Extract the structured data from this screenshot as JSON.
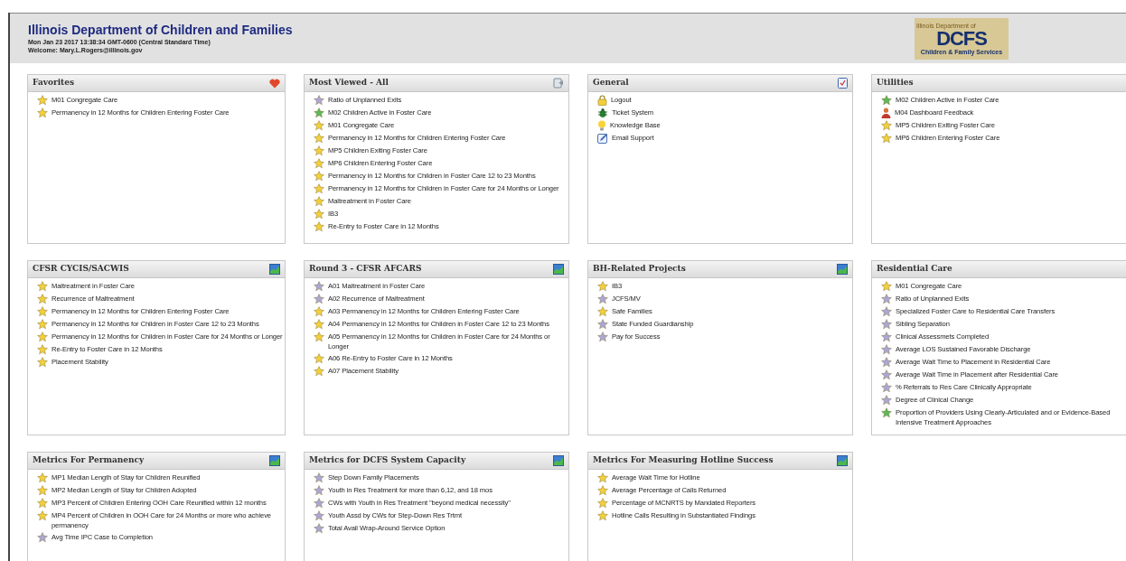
{
  "header": {
    "title": "Illinois Department of Children and Families",
    "datetime": "Mon Jan 23 2017 13:38:34 GMT-0600 (Central Standard Time)",
    "welcome": "Welcome: Mary.L.Rogers@illinois.gov",
    "logo": {
      "top": "Illinois Department of",
      "main": "DCFS",
      "bottom": "Children & Family Services"
    }
  },
  "panels": [
    {
      "title": "Favorites",
      "kind": "heart",
      "items": [
        {
          "kind": "star",
          "color": "#f2cf3b",
          "label": "M01 Congregate Care"
        },
        {
          "kind": "star",
          "color": "#f2cf3b",
          "label": "Permanency in 12 Months for Children Entering Foster Care"
        }
      ]
    },
    {
      "title": "Most Viewed - All",
      "kind": "report",
      "items": [
        {
          "kind": "star",
          "color": "#aaa7d8",
          "label": "Ratio of Unplanned Exits"
        },
        {
          "kind": "star",
          "color": "#5cb85c",
          "label": "M02 Children Active in Foster Care"
        },
        {
          "kind": "star",
          "color": "#f2cf3b",
          "label": "M01 Congregate Care"
        },
        {
          "kind": "star",
          "color": "#f2cf3b",
          "label": "Permanency in 12 Months for Children Entering Foster Care"
        },
        {
          "kind": "star",
          "color": "#f2cf3b",
          "label": "MP5 Children Exiting Foster Care"
        },
        {
          "kind": "star",
          "color": "#f2cf3b",
          "label": "MP6 Children Entering Foster Care"
        },
        {
          "kind": "star",
          "color": "#f2cf3b",
          "label": "Permanency in 12 Months for Children in Foster Care 12 to 23 Months"
        },
        {
          "kind": "star",
          "color": "#f2cf3b",
          "label": "Permanency in 12 Months for Children in Foster Care for 24 Months or Longer"
        },
        {
          "kind": "star",
          "color": "#f2cf3b",
          "label": "Maltreatment in Foster Care"
        },
        {
          "kind": "star",
          "color": "#f2cf3b",
          "label": "IB3"
        },
        {
          "kind": "star",
          "color": "#f2cf3b",
          "label": "Re-Entry to Foster Care in 12 Months"
        }
      ]
    },
    {
      "title": "General",
      "kind": "checklist",
      "items": [
        {
          "kind": "lock",
          "label": "Logout"
        },
        {
          "kind": "bug",
          "label": "Ticket System"
        },
        {
          "kind": "bulb",
          "label": "Knowledge Base"
        },
        {
          "kind": "edit",
          "label": "Email Support"
        }
      ]
    },
    {
      "title": "Utilities",
      "items": [
        {
          "kind": "star",
          "color": "#5cb85c",
          "label": "M02 Children Active in Foster Care"
        },
        {
          "kind": "person",
          "label": "M04 Dashboard Feedback"
        },
        {
          "kind": "star",
          "color": "#f2cf3b",
          "label": "MP5 Children Exiting Foster Care"
        },
        {
          "kind": "star",
          "color": "#f2cf3b",
          "label": "MP6 Children Entering Foster Care"
        }
      ]
    },
    {
      "title": "CFSR CYCIS/SACWIS",
      "kind": "chart",
      "items": [
        {
          "kind": "star",
          "color": "#f2cf3b",
          "label": "Maltreatment in Foster Care"
        },
        {
          "kind": "star",
          "color": "#f2cf3b",
          "label": "Recurrence of Maltreatment"
        },
        {
          "kind": "star",
          "color": "#f2cf3b",
          "label": "Permanency in 12 Months for Children Entering Foster Care"
        },
        {
          "kind": "star",
          "color": "#f2cf3b",
          "label": "Permanency in 12 Months for Children in Foster Care 12 to 23 Months"
        },
        {
          "kind": "star",
          "color": "#f2cf3b",
          "label": "Permanency in 12 Months for Children in Foster Care for 24 Months or Longer"
        },
        {
          "kind": "star",
          "color": "#f2cf3b",
          "label": "Re-Entry to Foster Care in 12 Months"
        },
        {
          "kind": "star",
          "color": "#f2cf3b",
          "label": "Placement Stability"
        }
      ]
    },
    {
      "title": "Round 3 - CFSR AFCARS",
      "kind": "chart",
      "items": [
        {
          "kind": "star",
          "color": "#aaa7d8",
          "label": "A01 Maltreatment in Foster Care"
        },
        {
          "kind": "star",
          "color": "#aaa7d8",
          "label": "A02 Recurrence of Maltreatment"
        },
        {
          "kind": "star",
          "color": "#f2cf3b",
          "label": "A03 Permanency in 12 Months for Children Entering Foster Care"
        },
        {
          "kind": "star",
          "color": "#f2cf3b",
          "label": "A04 Permanency in 12 Months for Children in Foster Care 12 to 23 Months"
        },
        {
          "kind": "star",
          "color": "#f2cf3b",
          "label": "A05 Permanency in 12 Months for Children in Foster Care for 24 Months or Longer"
        },
        {
          "kind": "star",
          "color": "#f2cf3b",
          "label": "A06 Re-Entry to Foster Care in 12 Months"
        },
        {
          "kind": "star",
          "color": "#f2cf3b",
          "label": "A07 Placement Stability"
        }
      ]
    },
    {
      "title": "BH-Related Projects",
      "kind": "chart",
      "items": [
        {
          "kind": "star",
          "color": "#f2cf3b",
          "label": "IB3"
        },
        {
          "kind": "star",
          "color": "#aaa7d8",
          "label": "JCFS/MV"
        },
        {
          "kind": "star",
          "color": "#f2cf3b",
          "label": "Safe Families"
        },
        {
          "kind": "star",
          "color": "#aaa7d8",
          "label": "State Funded Guardianship"
        },
        {
          "kind": "star",
          "color": "#aaa7d8",
          "label": "Pay for Success"
        }
      ]
    },
    {
      "title": "Residential Care",
      "items": [
        {
          "kind": "star",
          "color": "#f2cf3b",
          "label": "M01 Congregate Care"
        },
        {
          "kind": "star",
          "color": "#aaa7d8",
          "label": "Ratio of Unplanned Exits"
        },
        {
          "kind": "star",
          "color": "#aaa7d8",
          "label": "Specialized Foster Care to Residential Care Transfers"
        },
        {
          "kind": "star",
          "color": "#aaa7d8",
          "label": "Sibling Separation"
        },
        {
          "kind": "star",
          "color": "#aaa7d8",
          "label": "Clinical Assessmets Completed"
        },
        {
          "kind": "star",
          "color": "#aaa7d8",
          "label": "Average LOS Sustained Favorable Discharge"
        },
        {
          "kind": "star",
          "color": "#aaa7d8",
          "label": "Average Wait Time to Placement in Residential Care"
        },
        {
          "kind": "star",
          "color": "#aaa7d8",
          "label": "Average Wait Time in Placement after Residential Care"
        },
        {
          "kind": "star",
          "color": "#aaa7d8",
          "label": "% Referrals to Res Care Clinically Appropriate"
        },
        {
          "kind": "star",
          "color": "#aaa7d8",
          "label": "Degree of Clinical Change"
        },
        {
          "kind": "star",
          "color": "#5cb85c",
          "label": "Proportion of Providers Using Clearly-Articulated and or Evidence-Based Intensive Treatment Approaches"
        }
      ]
    },
    {
      "title": "Metrics For Permanency",
      "kind": "chart",
      "items": [
        {
          "kind": "star",
          "color": "#f2cf3b",
          "label": "MP1 Median Length of Stay for Children Reunified"
        },
        {
          "kind": "star",
          "color": "#f2cf3b",
          "label": "MP2 Median Length of Stay for Children Adopted"
        },
        {
          "kind": "star",
          "color": "#f2cf3b",
          "label": "MP3 Percent of Children Entering OOH Care Reunified within 12 months"
        },
        {
          "kind": "star",
          "color": "#f2cf3b",
          "label": "MP4 Percent of Children in OOH Care for 24 Months or more who achieve permanency"
        },
        {
          "kind": "star",
          "color": "#aaa7d8",
          "label": "Avg Time IPC Case to Completion"
        }
      ]
    },
    {
      "title": "Metrics for DCFS System Capacity",
      "kind": "chart",
      "items": [
        {
          "kind": "star",
          "color": "#aaa7d8",
          "label": "Step Down Family Placements"
        },
        {
          "kind": "star",
          "color": "#aaa7d8",
          "label": "Youth in Res Treatment for more than 6,12, and 18 mos"
        },
        {
          "kind": "star",
          "color": "#aaa7d8",
          "label": "CWs with Youth in Res Treatment \"beyond medical necessity\""
        },
        {
          "kind": "star",
          "color": "#aaa7d8",
          "label": "Youth Assd by CWs for Step-Down Res Trtmt"
        },
        {
          "kind": "star",
          "color": "#aaa7d8",
          "label": "Total Avail Wrap-Around Service Option"
        }
      ]
    },
    {
      "title": "Metrics For Measuring Hotline Success",
      "kind": "chart",
      "items": [
        {
          "kind": "star",
          "color": "#f2cf3b",
          "label": "Average Wait Time for Hotline"
        },
        {
          "kind": "star",
          "color": "#f2cf3b",
          "label": "Average Percentage of Calls Returned"
        },
        {
          "kind": "star",
          "color": "#f2cf3b",
          "label": "Percentage of MCNRTS by Mandated Reporters"
        },
        {
          "kind": "star",
          "color": "#f2cf3b",
          "label": "Hotline Calls Resulting in Substantiated Findings"
        }
      ]
    }
  ]
}
